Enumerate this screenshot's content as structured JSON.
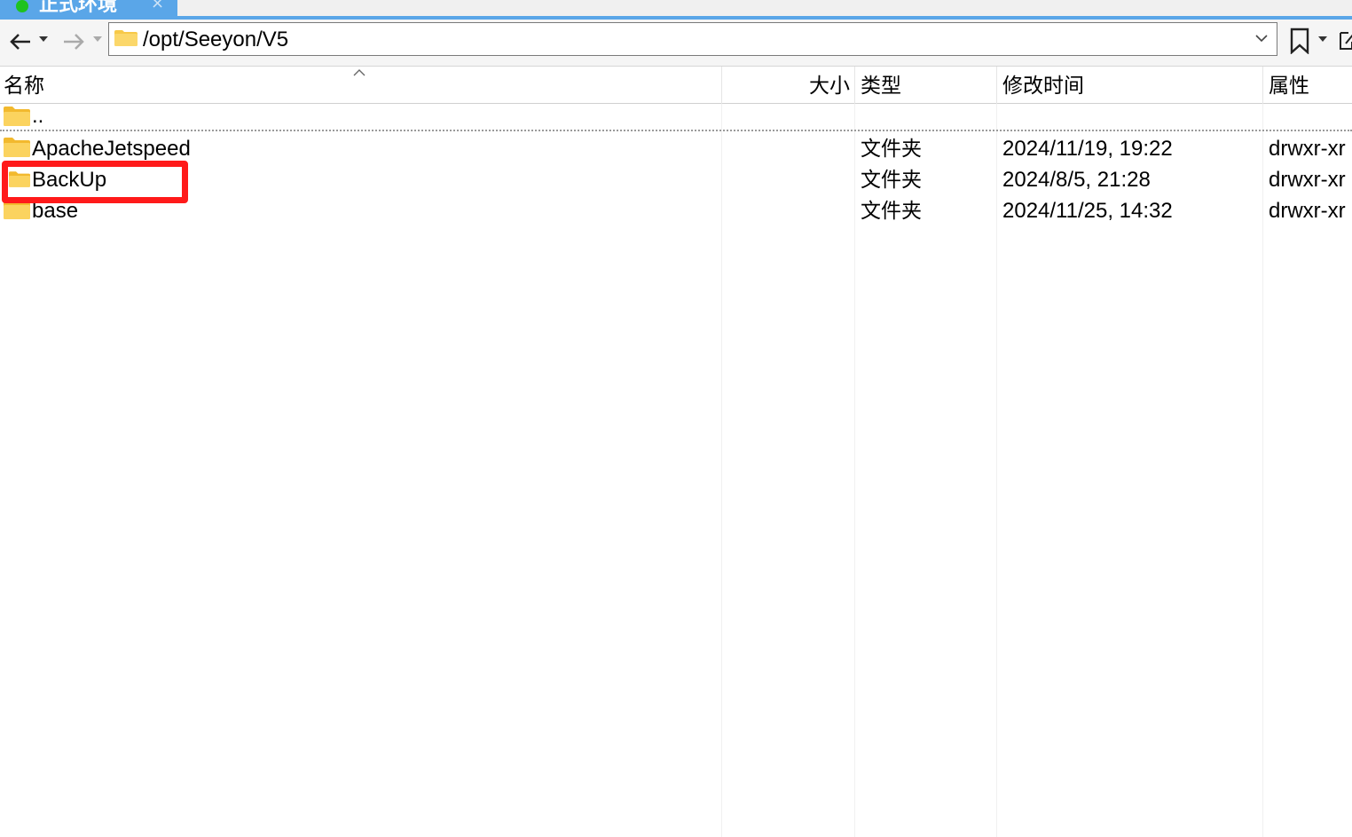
{
  "tab": {
    "label": "正式环境",
    "close": "×"
  },
  "toolbar": {
    "back_icon": "arrow-left-icon",
    "forward_icon": "arrow-right-icon",
    "path": "/opt/Seeyon/V5"
  },
  "columns": {
    "name": "名称",
    "size": "大小",
    "type": "类型",
    "modified": "修改时间",
    "attributes": "属性"
  },
  "parent_row": {
    "name": ".."
  },
  "rows": [
    {
      "name": "ApacheJetspeed",
      "size": "",
      "type": "文件夹",
      "modified": "2024/11/19, 19:22",
      "attributes": "drwxr-xr"
    },
    {
      "name": "BackUp",
      "size": "",
      "type": "文件夹",
      "modified": "2024/8/5, 21:28",
      "attributes": "drwxr-xr"
    },
    {
      "name": "base",
      "size": "",
      "type": "文件夹",
      "modified": "2024/11/25, 14:32",
      "attributes": "drwxr-xr"
    }
  ],
  "colors": {
    "tab_active": "#5aa6e8",
    "status_dot": "#1fc21f",
    "highlight": "#ff1a1a",
    "folder": "#f7c948"
  }
}
